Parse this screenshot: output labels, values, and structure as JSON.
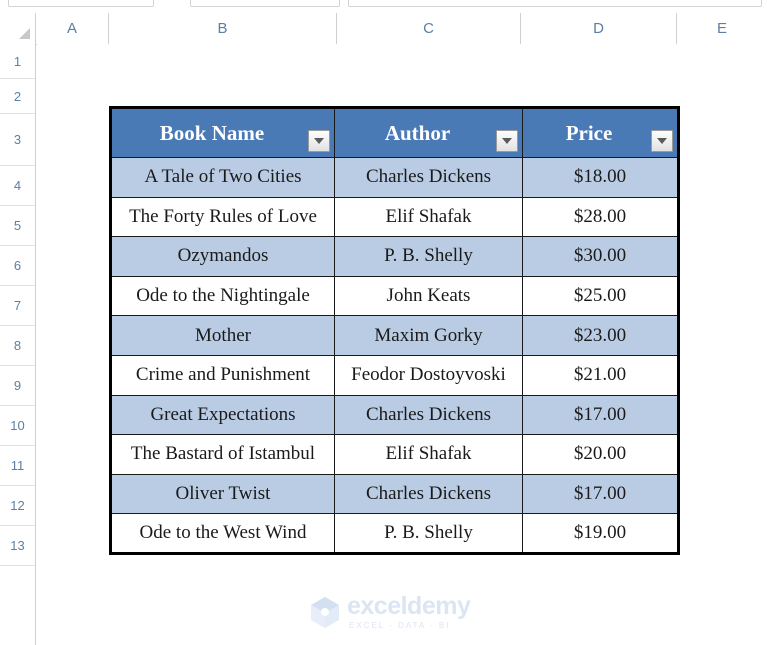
{
  "app": {
    "type": "spreadsheet"
  },
  "grid": {
    "column_headers": [
      "A",
      "B",
      "C",
      "D",
      "E"
    ],
    "row_headers": [
      "1",
      "2",
      "3",
      "4",
      "5",
      "6",
      "7",
      "8",
      "9",
      "10",
      "11",
      "12",
      "13"
    ]
  },
  "table": {
    "columns": [
      {
        "label": "Book Name",
        "filter_icon": "filter-dropdown-icon"
      },
      {
        "label": "Author",
        "filter_icon": "filter-dropdown-icon"
      },
      {
        "label": "Price",
        "filter_icon": "filter-dropdown-icon"
      }
    ],
    "rows": [
      {
        "book": "A Tale of Two Cities",
        "author": "Charles Dickens",
        "price": "$18.00"
      },
      {
        "book": "The Forty Rules of Love",
        "author": "Elif Shafak",
        "price": "$28.00"
      },
      {
        "book": "Ozymandos",
        "author": "P. B. Shelly",
        "price": "$30.00"
      },
      {
        "book": "Ode to the Nightingale",
        "author": "John Keats",
        "price": "$25.00"
      },
      {
        "book": "Mother",
        "author": "Maxim Gorky",
        "price": "$23.00"
      },
      {
        "book": "Crime and Punishment",
        "author": "Feodor Dostoyvoski",
        "price": "$21.00"
      },
      {
        "book": "Great Expectations",
        "author": "Charles Dickens",
        "price": "$17.00"
      },
      {
        "book": "The Bastard of Istambul",
        "author": "Elif Shafak",
        "price": "$20.00"
      },
      {
        "book": "Oliver Twist",
        "author": "Charles Dickens",
        "price": "$17.00"
      },
      {
        "book": "Ode to the West Wind",
        "author": "P. B. Shelly",
        "price": "$19.00"
      }
    ],
    "colors": {
      "header_background": "#4a7ab5",
      "header_text": "#ffffff",
      "banded_row": "#b9cce4",
      "plain_row": "#ffffff",
      "border": "#000000"
    }
  },
  "watermark": {
    "title": "exceldemy",
    "subtitle": "EXCEL - DATA - BI",
    "color": "#dbe5f3"
  }
}
